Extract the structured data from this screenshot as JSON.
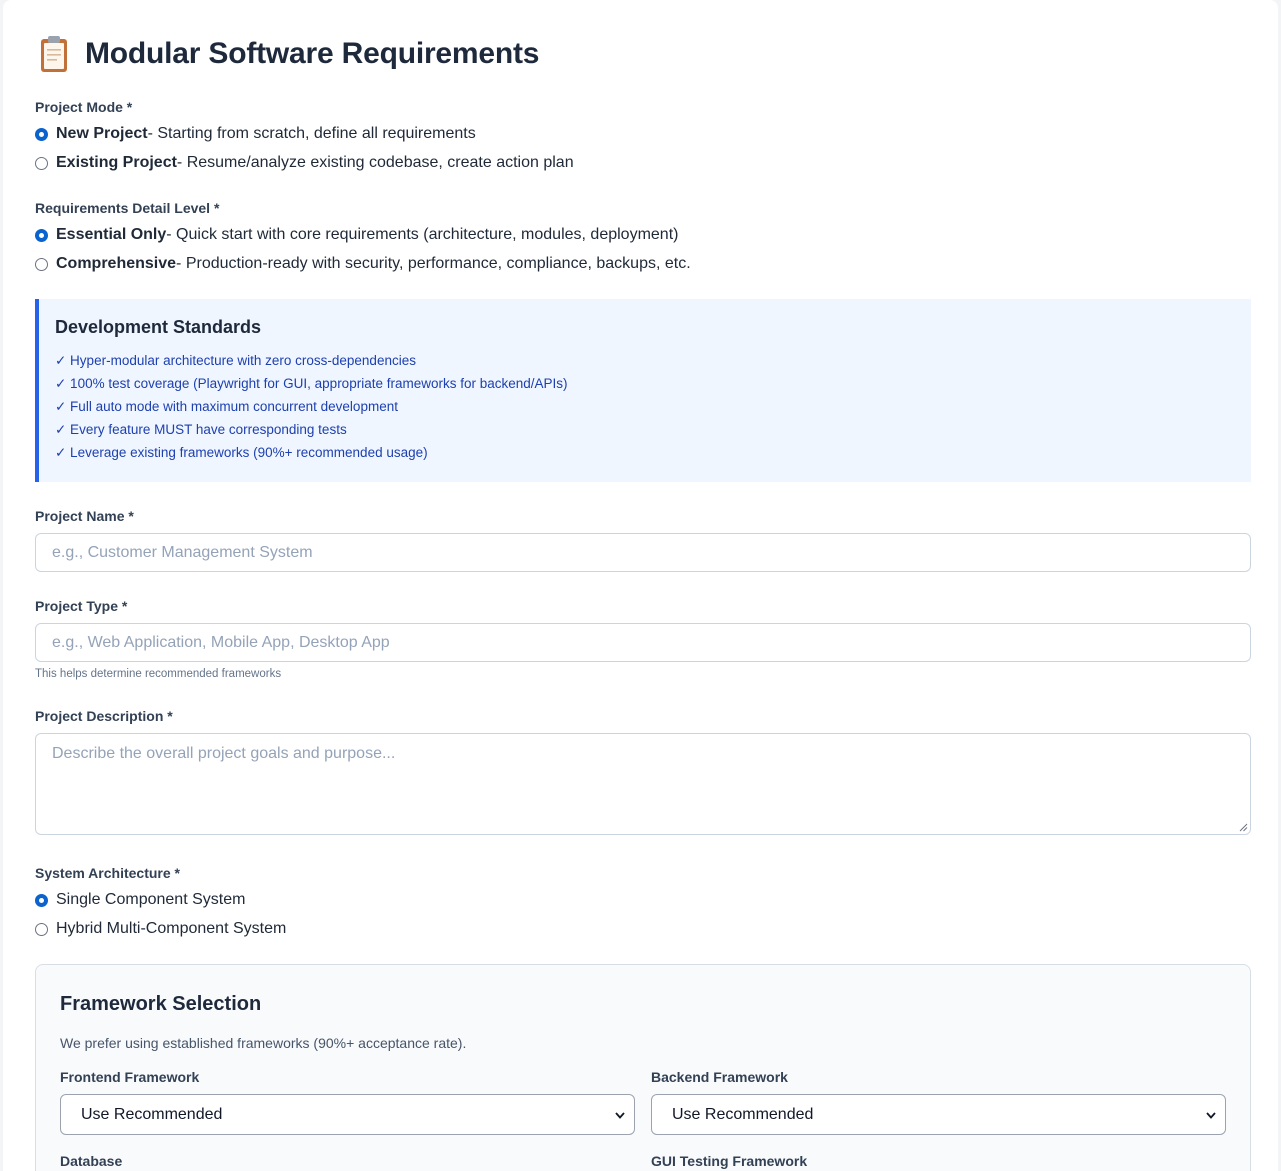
{
  "header": {
    "title": "Modular Software Requirements",
    "icon": "clipboard-icon"
  },
  "project_mode": {
    "label": "Project Mode *",
    "options": [
      {
        "title": "New Project",
        "desc": " - Starting from scratch, define all requirements",
        "selected": true
      },
      {
        "title": "Existing Project",
        "desc": " - Resume/analyze existing codebase, create action plan",
        "selected": false
      }
    ]
  },
  "detail_level": {
    "label": "Requirements Detail Level *",
    "options": [
      {
        "title": "Essential Only",
        "desc": " - Quick start with core requirements (architecture, modules, deployment)",
        "selected": true
      },
      {
        "title": "Comprehensive",
        "desc": " - Production-ready with security, performance, compliance, backups, etc.",
        "selected": false
      }
    ]
  },
  "standards": {
    "title": "Development Standards",
    "items": [
      "✓ Hyper-modular architecture with zero cross-dependencies",
      "✓ 100% test coverage (Playwright for GUI, appropriate frameworks for backend/APIs)",
      "✓ Full auto mode with maximum concurrent development",
      "✓ Every feature MUST have corresponding tests",
      "✓ Leverage existing frameworks (90%+ recommended usage)"
    ]
  },
  "project_name": {
    "label": "Project Name *",
    "placeholder": "e.g., Customer Management System",
    "value": ""
  },
  "project_type": {
    "label": "Project Type *",
    "placeholder": "e.g., Web Application, Mobile App, Desktop App",
    "hint": "This helps determine recommended frameworks",
    "value": ""
  },
  "project_description": {
    "label": "Project Description *",
    "placeholder": "Describe the overall project goals and purpose...",
    "value": ""
  },
  "architecture": {
    "label": "System Architecture *",
    "options": [
      {
        "title": "Single Component System",
        "selected": true
      },
      {
        "title": "Hybrid Multi-Component System",
        "selected": false
      }
    ]
  },
  "framework_selection": {
    "title": "Framework Selection",
    "description": "We prefer using established frameworks (90%+ acceptance rate).",
    "frontend": {
      "label": "Frontend Framework",
      "value": "Use Recommended"
    },
    "backend": {
      "label": "Backend Framework",
      "value": "Use Recommended"
    },
    "database": {
      "label": "Database"
    },
    "gui_testing": {
      "label": "GUI Testing Framework"
    }
  },
  "colors": {
    "accent": "#2563eb",
    "radio": "#0b63ce",
    "standards_bg": "#eff6ff",
    "standards_text": "#1e40af"
  }
}
